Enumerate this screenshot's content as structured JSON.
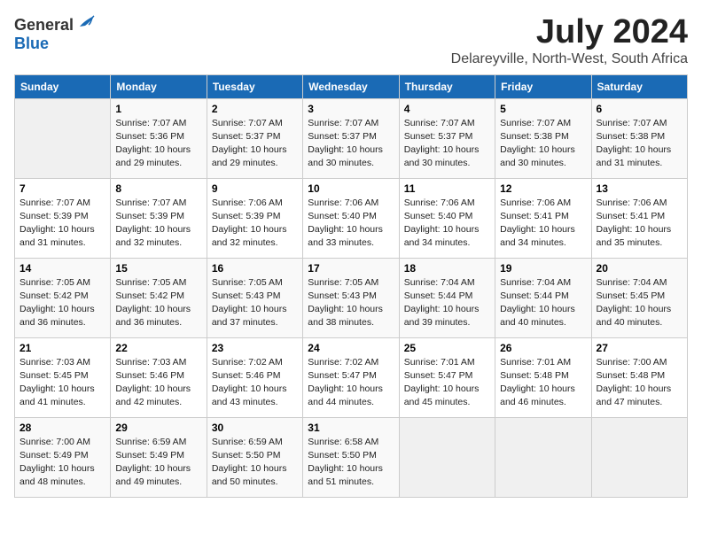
{
  "logo": {
    "general": "General",
    "blue": "Blue"
  },
  "title": "July 2024",
  "location": "Delareyville, North-West, South Africa",
  "days_header": [
    "Sunday",
    "Monday",
    "Tuesday",
    "Wednesday",
    "Thursday",
    "Friday",
    "Saturday"
  ],
  "weeks": [
    [
      {
        "day": "",
        "info": ""
      },
      {
        "day": "1",
        "info": "Sunrise: 7:07 AM\nSunset: 5:36 PM\nDaylight: 10 hours\nand 29 minutes."
      },
      {
        "day": "2",
        "info": "Sunrise: 7:07 AM\nSunset: 5:37 PM\nDaylight: 10 hours\nand 29 minutes."
      },
      {
        "day": "3",
        "info": "Sunrise: 7:07 AM\nSunset: 5:37 PM\nDaylight: 10 hours\nand 30 minutes."
      },
      {
        "day": "4",
        "info": "Sunrise: 7:07 AM\nSunset: 5:37 PM\nDaylight: 10 hours\nand 30 minutes."
      },
      {
        "day": "5",
        "info": "Sunrise: 7:07 AM\nSunset: 5:38 PM\nDaylight: 10 hours\nand 30 minutes."
      },
      {
        "day": "6",
        "info": "Sunrise: 7:07 AM\nSunset: 5:38 PM\nDaylight: 10 hours\nand 31 minutes."
      }
    ],
    [
      {
        "day": "7",
        "info": "Sunrise: 7:07 AM\nSunset: 5:39 PM\nDaylight: 10 hours\nand 31 minutes."
      },
      {
        "day": "8",
        "info": "Sunrise: 7:07 AM\nSunset: 5:39 PM\nDaylight: 10 hours\nand 32 minutes."
      },
      {
        "day": "9",
        "info": "Sunrise: 7:06 AM\nSunset: 5:39 PM\nDaylight: 10 hours\nand 32 minutes."
      },
      {
        "day": "10",
        "info": "Sunrise: 7:06 AM\nSunset: 5:40 PM\nDaylight: 10 hours\nand 33 minutes."
      },
      {
        "day": "11",
        "info": "Sunrise: 7:06 AM\nSunset: 5:40 PM\nDaylight: 10 hours\nand 34 minutes."
      },
      {
        "day": "12",
        "info": "Sunrise: 7:06 AM\nSunset: 5:41 PM\nDaylight: 10 hours\nand 34 minutes."
      },
      {
        "day": "13",
        "info": "Sunrise: 7:06 AM\nSunset: 5:41 PM\nDaylight: 10 hours\nand 35 minutes."
      }
    ],
    [
      {
        "day": "14",
        "info": "Sunrise: 7:05 AM\nSunset: 5:42 PM\nDaylight: 10 hours\nand 36 minutes."
      },
      {
        "day": "15",
        "info": "Sunrise: 7:05 AM\nSunset: 5:42 PM\nDaylight: 10 hours\nand 36 minutes."
      },
      {
        "day": "16",
        "info": "Sunrise: 7:05 AM\nSunset: 5:43 PM\nDaylight: 10 hours\nand 37 minutes."
      },
      {
        "day": "17",
        "info": "Sunrise: 7:05 AM\nSunset: 5:43 PM\nDaylight: 10 hours\nand 38 minutes."
      },
      {
        "day": "18",
        "info": "Sunrise: 7:04 AM\nSunset: 5:44 PM\nDaylight: 10 hours\nand 39 minutes."
      },
      {
        "day": "19",
        "info": "Sunrise: 7:04 AM\nSunset: 5:44 PM\nDaylight: 10 hours\nand 40 minutes."
      },
      {
        "day": "20",
        "info": "Sunrise: 7:04 AM\nSunset: 5:45 PM\nDaylight: 10 hours\nand 40 minutes."
      }
    ],
    [
      {
        "day": "21",
        "info": "Sunrise: 7:03 AM\nSunset: 5:45 PM\nDaylight: 10 hours\nand 41 minutes."
      },
      {
        "day": "22",
        "info": "Sunrise: 7:03 AM\nSunset: 5:46 PM\nDaylight: 10 hours\nand 42 minutes."
      },
      {
        "day": "23",
        "info": "Sunrise: 7:02 AM\nSunset: 5:46 PM\nDaylight: 10 hours\nand 43 minutes."
      },
      {
        "day": "24",
        "info": "Sunrise: 7:02 AM\nSunset: 5:47 PM\nDaylight: 10 hours\nand 44 minutes."
      },
      {
        "day": "25",
        "info": "Sunrise: 7:01 AM\nSunset: 5:47 PM\nDaylight: 10 hours\nand 45 minutes."
      },
      {
        "day": "26",
        "info": "Sunrise: 7:01 AM\nSunset: 5:48 PM\nDaylight: 10 hours\nand 46 minutes."
      },
      {
        "day": "27",
        "info": "Sunrise: 7:00 AM\nSunset: 5:48 PM\nDaylight: 10 hours\nand 47 minutes."
      }
    ],
    [
      {
        "day": "28",
        "info": "Sunrise: 7:00 AM\nSunset: 5:49 PM\nDaylight: 10 hours\nand 48 minutes."
      },
      {
        "day": "29",
        "info": "Sunrise: 6:59 AM\nSunset: 5:49 PM\nDaylight: 10 hours\nand 49 minutes."
      },
      {
        "day": "30",
        "info": "Sunrise: 6:59 AM\nSunset: 5:50 PM\nDaylight: 10 hours\nand 50 minutes."
      },
      {
        "day": "31",
        "info": "Sunrise: 6:58 AM\nSunset: 5:50 PM\nDaylight: 10 hours\nand 51 minutes."
      },
      {
        "day": "",
        "info": ""
      },
      {
        "day": "",
        "info": ""
      },
      {
        "day": "",
        "info": ""
      }
    ]
  ]
}
